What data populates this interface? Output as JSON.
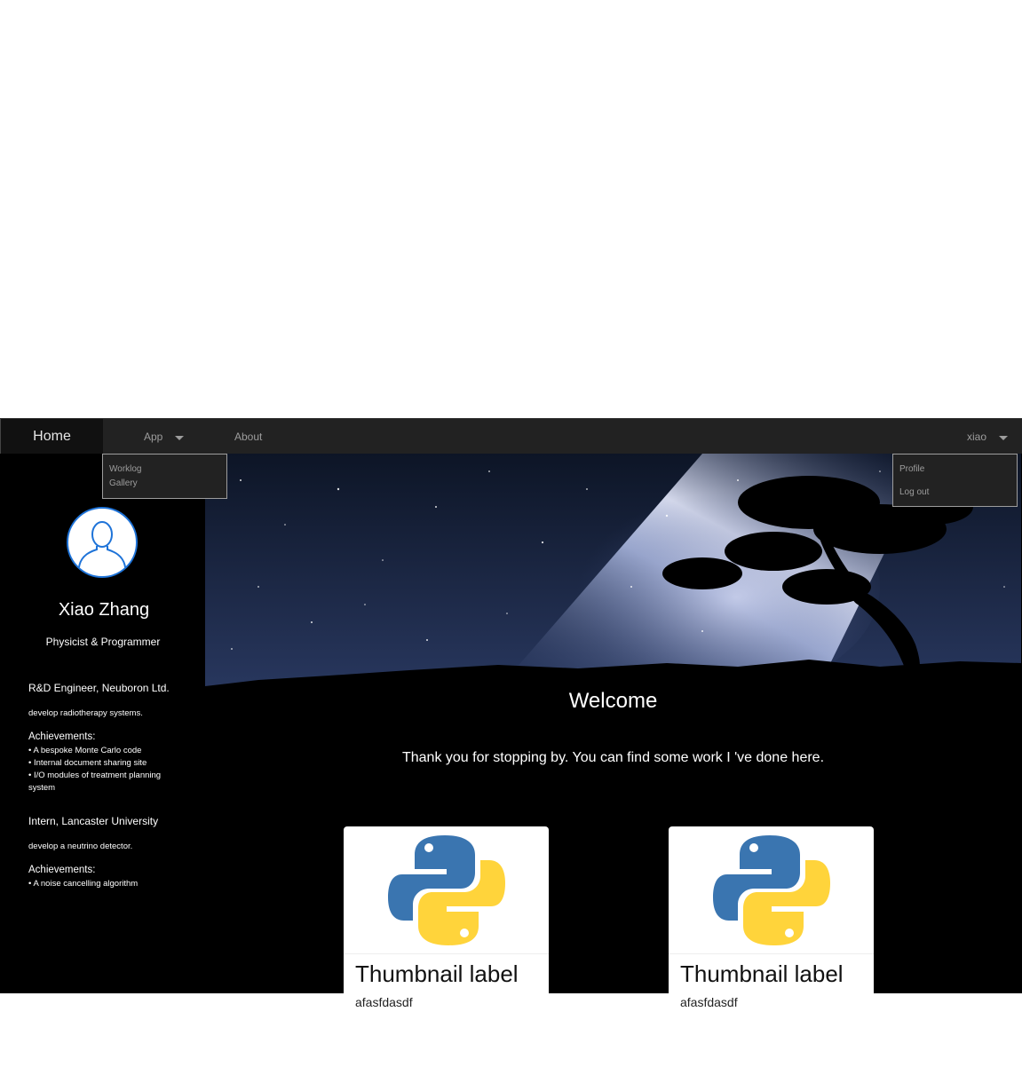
{
  "navbar": {
    "home_label": "Home",
    "app_label": "App",
    "about_label": "About",
    "user_label": "xiao"
  },
  "app_menu": {
    "items": [
      "Worklog",
      "Gallery"
    ]
  },
  "user_menu": {
    "items": [
      "Profile",
      "Log out"
    ]
  },
  "profile": {
    "name": "Xiao Zhang",
    "tagline": "Physicist & Programmer"
  },
  "experience": [
    {
      "title": "R&D Engineer, Neuboron Ltd.",
      "description": "develop radiotherapy systems.",
      "achievements_heading": "Achievements:",
      "achievements": [
        "• A bespoke Monte Carlo code",
        "• Internal document sharing site",
        "• I/O modules of treatment planning system"
      ]
    },
    {
      "title": "Intern, Lancaster University",
      "description": "develop a neutrino detector.",
      "achievements_heading": "Achievements:",
      "achievements": [
        "• A noise cancelling algorithm"
      ]
    }
  ],
  "main": {
    "welcome": "Welcome",
    "intro": "Thank you for stopping by. You can find some work I 've done here."
  },
  "thumbnails": [
    {
      "label": "Thumbnail label",
      "caption": "afasfdasdf",
      "icon": "python-logo-icon"
    },
    {
      "label": "Thumbnail label",
      "caption": "afasfdasdf",
      "icon": "python-logo-icon"
    }
  ],
  "colors": {
    "navbar_bg": "#222222",
    "avatar_accent": "#1e73d8",
    "python_blue": "#3a75b0",
    "python_yellow": "#ffd43b"
  }
}
